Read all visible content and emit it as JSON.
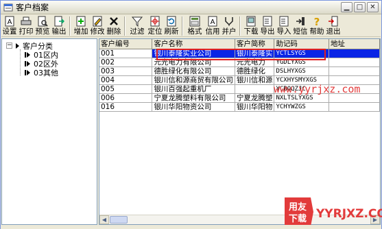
{
  "window": {
    "title": "客户档案",
    "controls": [
      "minimize",
      "restore",
      "close"
    ]
  },
  "toolbar": {
    "buttons": [
      {
        "label": "设置",
        "icon": "settings-icon"
      },
      {
        "label": "打印",
        "icon": "printer-icon"
      },
      {
        "label": "预览",
        "icon": "preview-icon"
      },
      {
        "label": "输出",
        "icon": "export-icon"
      },
      {
        "label": "增加",
        "icon": "add-icon"
      },
      {
        "label": "修改",
        "icon": "edit-icon"
      },
      {
        "label": "删除",
        "icon": "delete-icon"
      },
      {
        "label": "过滤",
        "icon": "filter-icon"
      },
      {
        "label": "定位",
        "icon": "locate-icon"
      },
      {
        "label": "刷新",
        "icon": "refresh-icon"
      },
      {
        "label": "格式",
        "icon": "format-icon"
      },
      {
        "label": "信用",
        "icon": "credit-icon"
      },
      {
        "label": "并户",
        "icon": "merge-icon"
      },
      {
        "label": "下载",
        "icon": "download-icon"
      },
      {
        "label": "导出",
        "icon": "export-out-icon"
      },
      {
        "label": "导入",
        "icon": "import-icon"
      },
      {
        "label": "短信",
        "icon": "sms-icon"
      },
      {
        "label": "帮助",
        "icon": "help-icon"
      },
      {
        "label": "退出",
        "icon": "exit-icon"
      }
    ]
  },
  "tree": {
    "root": "客户分类",
    "children": [
      "01区内",
      "02区外",
      "03其他"
    ]
  },
  "grid": {
    "columns": [
      "客户编号",
      "客户名称",
      "客户简称",
      "助记码",
      "地址"
    ],
    "rows": [
      {
        "code": "001",
        "name": "银川泰隆实业公司",
        "short": "银川泰隆实",
        "mnemonic": "YCTLSYGS",
        "address": ""
      },
      {
        "code": "002",
        "name": "元光电力有限公司",
        "short": "元光电力",
        "mnemonic": "YGDLYXGS",
        "address": ""
      },
      {
        "code": "003",
        "name": "德胜绿化有限公司",
        "short": "德胜绿化",
        "mnemonic": "DSLHYXGS",
        "address": ""
      },
      {
        "code": "004",
        "name": "银川信和源商贸有限公司",
        "short": "银川信和源",
        "mnemonic": "YCXHYSMYXGS",
        "address": ""
      },
      {
        "code": "005",
        "name": "银川百强起重机厂",
        "short": "",
        "mnemonic": "YCBQQZJC",
        "address": ""
      },
      {
        "code": "006",
        "name": "宁夏龙腾塑料有限公司",
        "short": "宁夏龙腾塑",
        "mnemonic": "NXLTSLYXGS",
        "address": ""
      },
      {
        "code": "016",
        "name": "银川华阳物资公司",
        "short": "银川华阳物",
        "mnemonic": "YCHYWZGS",
        "address": ""
      }
    ],
    "selected_row": 0
  },
  "watermark": {
    "url": "www.yyrjxz.com",
    "logo_cn_top": "用友",
    "logo_cn_bottom": "下载",
    "logo_domain": "YYRJXZ.COM"
  },
  "colors": {
    "selection": "#0a24e6",
    "highlight_box": "#e02020",
    "watermark": "#e23b3b",
    "chrome": "#ece9d8"
  }
}
